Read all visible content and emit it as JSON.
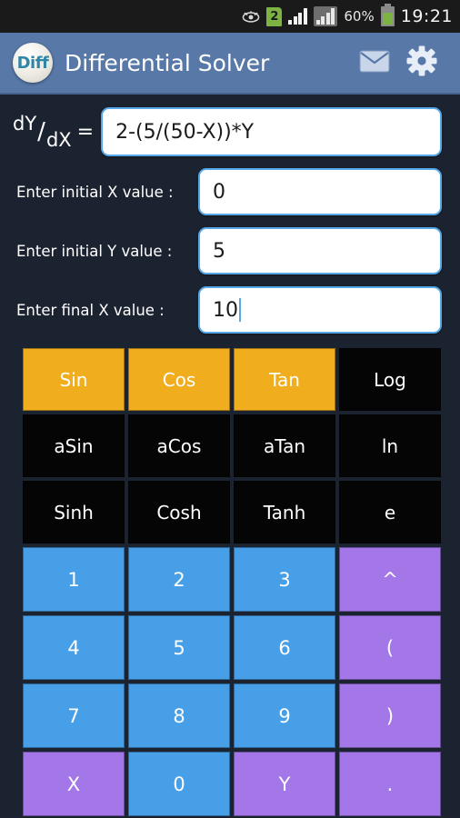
{
  "statusbar": {
    "eye_icon": "eye-icon",
    "sim_label": "2",
    "signal_icon": "signal-bars-icon",
    "signal2_icon": "signal-bars-dim-icon",
    "battery_percent": "60%",
    "battery_icon": "battery-icon",
    "time": "19:21"
  },
  "appbar": {
    "logo_text": "Diff",
    "title": "Differential Solver",
    "mail_icon": "mail-icon",
    "settings_icon": "gear-icon"
  },
  "equation": {
    "label_numerator": "dY",
    "label_slash": "/",
    "label_denominator": "dX",
    "label_equals": "=",
    "value": "2-(5/(50-X))*Y"
  },
  "inputs": [
    {
      "label": "Enter initial X value :",
      "value": "0",
      "focused": false
    },
    {
      "label": "Enter initial Y value :",
      "value": "5",
      "focused": false
    },
    {
      "label": "Enter final X value :",
      "value": "10",
      "focused": true
    }
  ],
  "keypad": {
    "rows": [
      [
        {
          "label": "Sin",
          "style": "fn-orange"
        },
        {
          "label": "Cos",
          "style": "fn-orange"
        },
        {
          "label": "Tan",
          "style": "fn-orange"
        },
        {
          "label": "Log",
          "style": "fn-black"
        }
      ],
      [
        {
          "label": "aSin",
          "style": "fn-black"
        },
        {
          "label": "aCos",
          "style": "fn-black"
        },
        {
          "label": "aTan",
          "style": "fn-black"
        },
        {
          "label": "ln",
          "style": "fn-black"
        }
      ],
      [
        {
          "label": "Sinh",
          "style": "fn-black"
        },
        {
          "label": "Cosh",
          "style": "fn-black"
        },
        {
          "label": "Tanh",
          "style": "fn-black"
        },
        {
          "label": "e",
          "style": "fn-black"
        }
      ],
      [
        {
          "label": "1",
          "style": "num"
        },
        {
          "label": "2",
          "style": "num"
        },
        {
          "label": "3",
          "style": "num"
        },
        {
          "label": "^",
          "style": "op"
        }
      ],
      [
        {
          "label": "4",
          "style": "num"
        },
        {
          "label": "5",
          "style": "num"
        },
        {
          "label": "6",
          "style": "num"
        },
        {
          "label": "(",
          "style": "op"
        }
      ],
      [
        {
          "label": "7",
          "style": "num"
        },
        {
          "label": "8",
          "style": "num"
        },
        {
          "label": "9",
          "style": "num"
        },
        {
          "label": ")",
          "style": "op"
        }
      ],
      [
        {
          "label": "X",
          "style": "op"
        },
        {
          "label": "0",
          "style": "num"
        },
        {
          "label": "Y",
          "style": "op"
        },
        {
          "label": ".",
          "style": "op"
        }
      ]
    ]
  },
  "colors": {
    "background": "#1c2330",
    "appbar": "#5878a8",
    "orange": "#f0ad1e",
    "blue": "#479fe8",
    "purple": "#a377e8",
    "black_key": "#050505",
    "field_border": "#56a8e8",
    "battery_green": "#7cb342"
  }
}
